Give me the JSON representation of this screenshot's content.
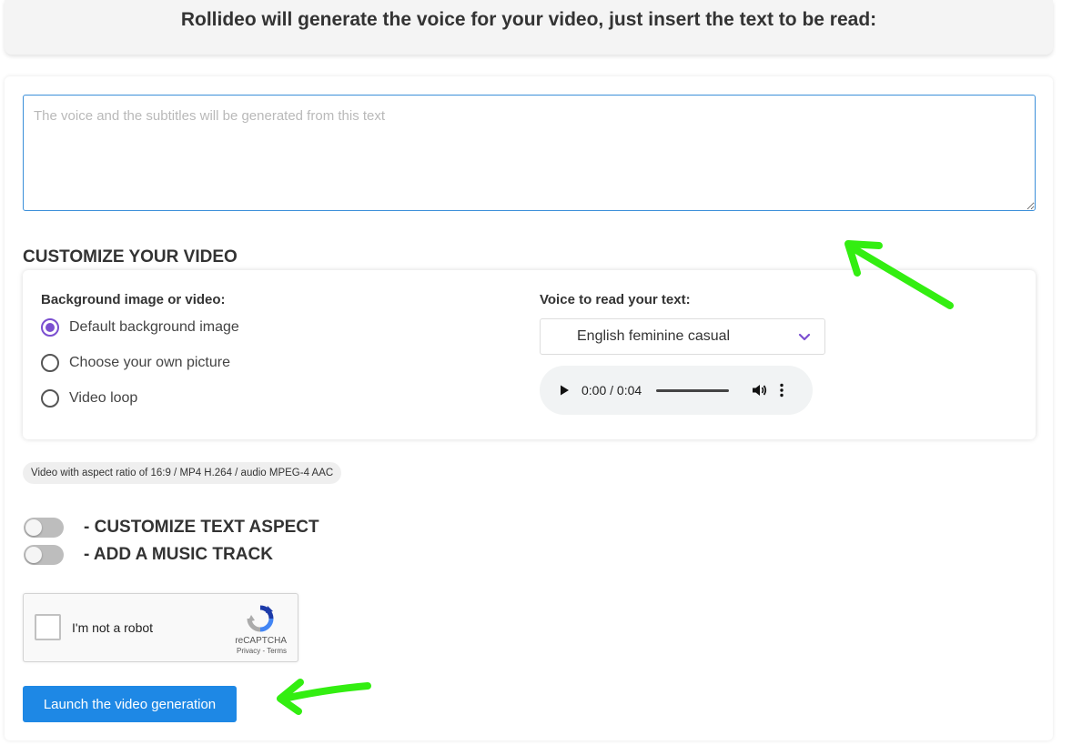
{
  "header": {
    "title": "Rollideo will generate the voice for your video, just insert the text to be read:"
  },
  "text_input": {
    "placeholder": "The voice and the subtitles will be generated from this text",
    "value": ""
  },
  "customize": {
    "title": "CUSTOMIZE YOUR VIDEO",
    "background": {
      "label": "Background image or video:",
      "options": [
        {
          "label": "Default background image",
          "checked": true
        },
        {
          "label": "Choose your own picture",
          "checked": false
        },
        {
          "label": "Video loop",
          "checked": false
        }
      ]
    },
    "voice": {
      "label": "Voice to read your text:",
      "selected": "English feminine casual",
      "audio_time": "0:00 / 0:04"
    }
  },
  "format_note": "Video with aspect ratio of 16:9 / MP4 H.264 / audio MPEG-4 AAC",
  "toggles": [
    {
      "label": "- CUSTOMIZE TEXT ASPECT",
      "on": false
    },
    {
      "label": "- ADD A MUSIC TRACK",
      "on": false
    }
  ],
  "recaptcha": {
    "label": "I'm not a robot",
    "brand": "reCAPTCHA",
    "privacy": "Privacy",
    "separator": "-",
    "terms": "Terms"
  },
  "launch_button": "Launch the video generation",
  "colors": {
    "accent_blue": "#1e88e5",
    "radio_purple": "#7b4fd0",
    "annotation_green": "#33ee11"
  },
  "annotations": [
    "arrow-to-text-area",
    "arrow-to-launch-button"
  ]
}
